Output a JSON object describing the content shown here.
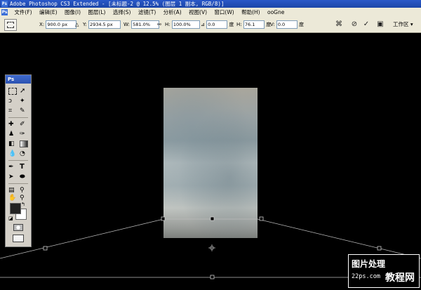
{
  "window": {
    "title": "Adobe Photoshop CS3 Extended - [未标题-2 @ 12.5% (图层 1 副本, RGB/8)]"
  },
  "menu": {
    "items": [
      "文件(F)",
      "编辑(E)",
      "图像(I)",
      "图层(L)",
      "选择(S)",
      "滤镜(T)",
      "分析(A)",
      "视图(V)",
      "窗口(W)",
      "帮助(H)",
      "ooGne"
    ]
  },
  "options": {
    "x_label": "X:",
    "x_value": "900.0 px",
    "y_label": "Y:",
    "y_value": "2934.5 px",
    "w_label": "W:",
    "w_value": "581.0%",
    "h_label": "H:",
    "h_value": "100.0%",
    "rot_value": "0.0",
    "rot_unit": "度",
    "hskew_label": "H:",
    "hskew_value": "76.1",
    "hskew_unit": "度",
    "vskew_label": "V:",
    "vskew_value": "0.0",
    "vskew_unit": "度",
    "workspace": "工作区 ▾"
  },
  "toolbox": {
    "logo": "Ps"
  },
  "watermark": {
    "line1": "图片处理",
    "line2": "22ps.com",
    "line3": "教程网"
  }
}
